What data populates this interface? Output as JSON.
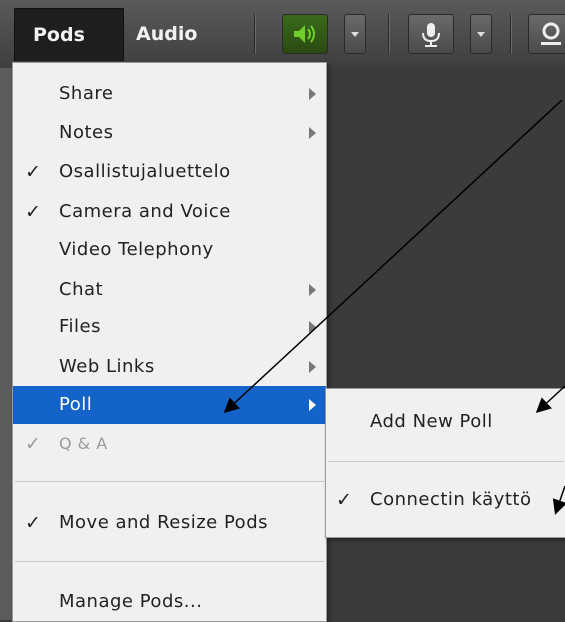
{
  "menubar": {
    "pods_label": "Pods",
    "audio_label": "Audio"
  },
  "pods_menu": {
    "items": [
      {
        "label": "Share",
        "checked": false,
        "has_submenu": true
      },
      {
        "label": "Notes",
        "checked": false,
        "has_submenu": true
      },
      {
        "label": "Osallistujaluettelo",
        "checked": true,
        "has_submenu": false
      },
      {
        "label": "Camera and Voice",
        "checked": true,
        "has_submenu": false
      },
      {
        "label": "Video Telephony",
        "checked": false,
        "has_submenu": false
      },
      {
        "label": "Chat",
        "checked": false,
        "has_submenu": true
      },
      {
        "label": "Files",
        "checked": false,
        "has_submenu": true
      },
      {
        "label": "Web Links",
        "checked": false,
        "has_submenu": true
      },
      {
        "label": "Poll",
        "checked": false,
        "has_submenu": true,
        "highlighted": true
      },
      {
        "label": "Q & A",
        "checked": true,
        "has_submenu": false,
        "disabled": true
      },
      {
        "label": "Move and Resize Pods",
        "checked": true,
        "has_submenu": false
      },
      {
        "label": "Manage Pods...",
        "checked": false,
        "has_submenu": false
      }
    ],
    "check_glyph": "✓"
  },
  "poll_submenu": {
    "items": [
      {
        "label": "Add New Poll",
        "checked": false
      },
      {
        "label": "Connectin käyttö",
        "checked": true
      }
    ]
  },
  "colors": {
    "highlight": "#1463c8",
    "speaker_active": "#6fcf2a",
    "menu_bg": "#f0f0f0"
  },
  "icons": [
    "speaker-icon",
    "microphone-icon",
    "webcam-icon"
  ]
}
